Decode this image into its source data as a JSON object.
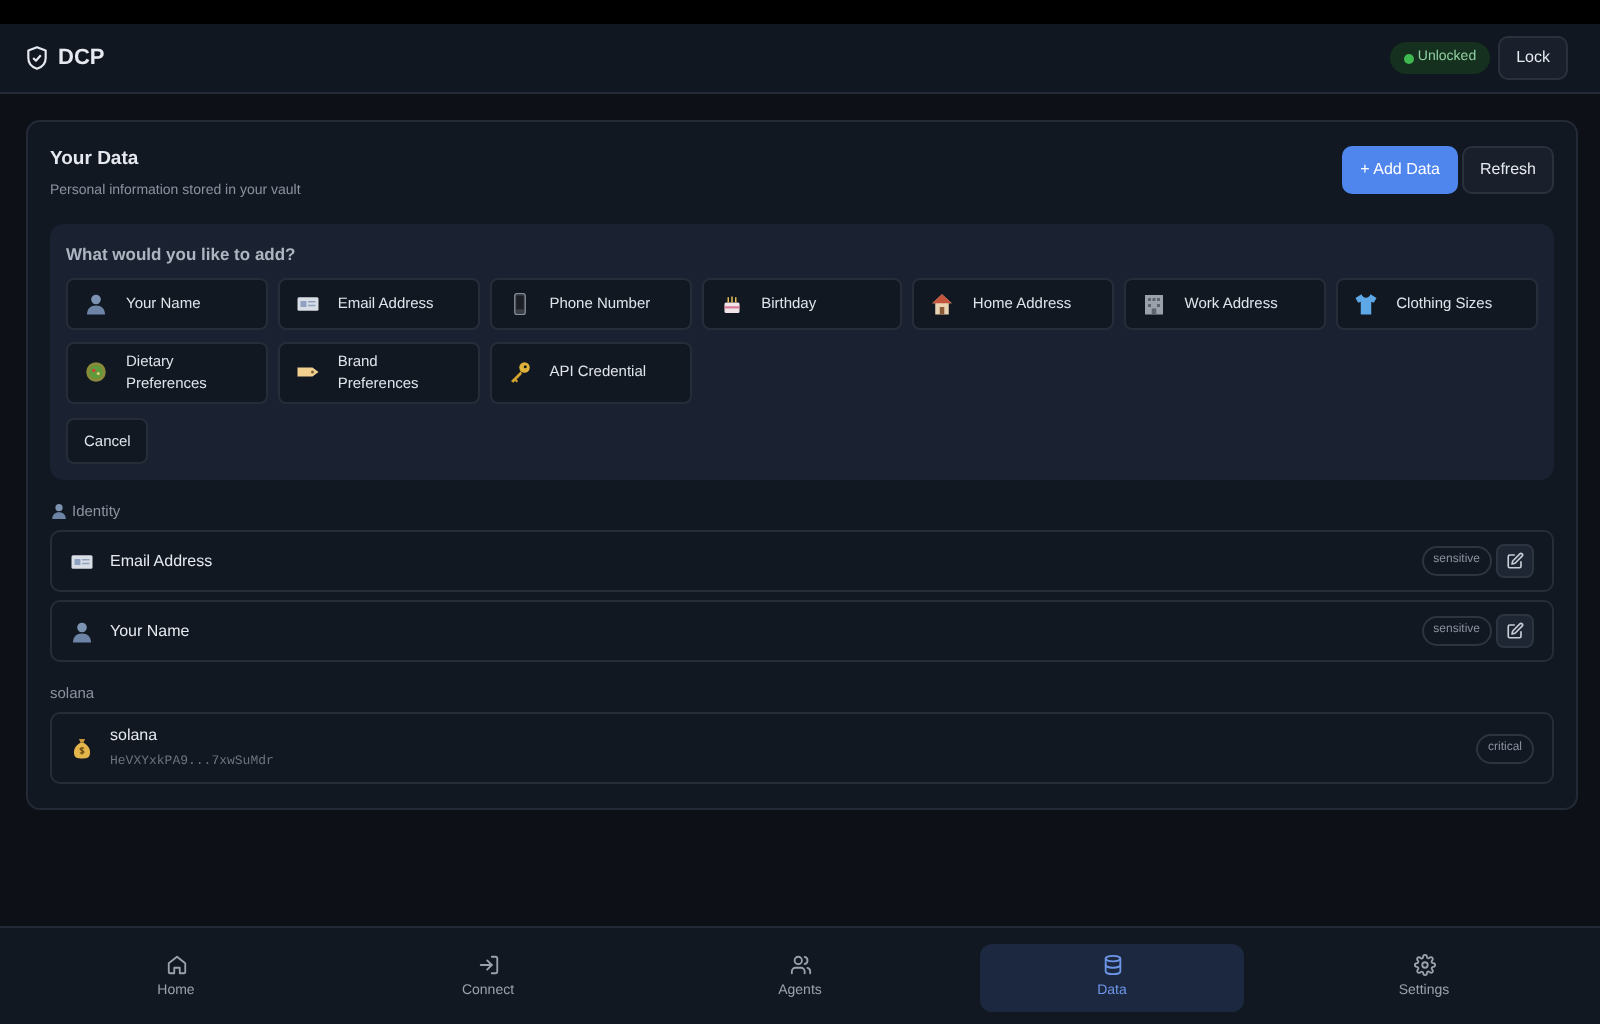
{
  "header": {
    "title": "DCP",
    "status": "Unlocked",
    "lock_button": "Lock"
  },
  "panel": {
    "title": "Your Data",
    "subtitle": "Personal information stored in your vault",
    "add_button": "+ Add Data",
    "refresh_button": "Refresh"
  },
  "add_menu": {
    "prompt": "What would you like to add?",
    "options": [
      {
        "label": "Your Name"
      },
      {
        "label": "Email Address"
      },
      {
        "label": "Phone Number"
      },
      {
        "label": "Birthday"
      },
      {
        "label": "Home Address"
      },
      {
        "label": "Work Address"
      },
      {
        "label": "Clothing Sizes"
      },
      {
        "label": "Dietary Preferences"
      },
      {
        "label": "Brand Preferences"
      },
      {
        "label": "API Credential"
      }
    ],
    "cancel_button": "Cancel"
  },
  "groups": [
    {
      "title": "Identity",
      "items": [
        {
          "name": "Email Address",
          "tag": "sensitive",
          "editable": true
        },
        {
          "name": "Your Name",
          "tag": "sensitive",
          "editable": true
        }
      ]
    },
    {
      "title": "solana",
      "items": [
        {
          "name": "solana",
          "detail": "HeVXYxkPA9...7xwSuMdr",
          "tag": "critical",
          "editable": false
        }
      ]
    }
  ],
  "nav": [
    {
      "label": "Home",
      "selected": false
    },
    {
      "label": "Connect",
      "selected": false
    },
    {
      "label": "Agents",
      "selected": false
    },
    {
      "label": "Data",
      "selected": true
    },
    {
      "label": "Settings",
      "selected": false
    }
  ]
}
